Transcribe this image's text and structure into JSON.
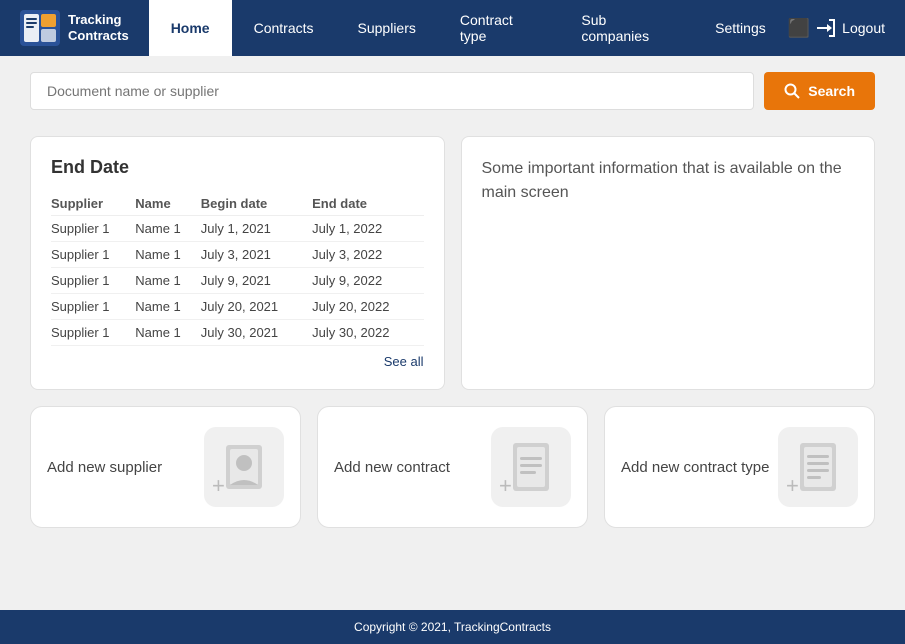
{
  "brand": {
    "name_line1": "Tracking",
    "name_line2": "Contracts"
  },
  "nav": {
    "tabs": [
      {
        "id": "home",
        "label": "Home",
        "active": true
      },
      {
        "id": "contracts",
        "label": "Contracts",
        "active": false
      },
      {
        "id": "suppliers",
        "label": "Suppliers",
        "active": false
      },
      {
        "id": "contract_type",
        "label": "Contract type",
        "active": false
      },
      {
        "id": "sub_companies",
        "label": "Sub companies",
        "active": false
      },
      {
        "id": "settings",
        "label": "Settings",
        "active": false
      }
    ],
    "logout_label": "Logout"
  },
  "search": {
    "placeholder": "Document name or supplier",
    "button_label": "Search"
  },
  "end_date_panel": {
    "title": "End Date",
    "columns": [
      "Supplier",
      "Name",
      "Begin date",
      "End date"
    ],
    "rows": [
      {
        "supplier": "Supplier 1",
        "name": "Name 1",
        "begin": "July 1, 2021",
        "end": "July 1, 2022"
      },
      {
        "supplier": "Supplier 1",
        "name": "Name 1",
        "begin": "July 3, 2021",
        "end": "July 3, 2022"
      },
      {
        "supplier": "Supplier 1",
        "name": "Name 1",
        "begin": "July 9, 2021",
        "end": "July 9, 2022"
      },
      {
        "supplier": "Supplier 1",
        "name": "Name 1",
        "begin": "July 20, 2021",
        "end": "July 20, 2022"
      },
      {
        "supplier": "Supplier 1",
        "name": "Name 1",
        "begin": "July 30, 2021",
        "end": "July 30, 2022"
      }
    ],
    "see_all_label": "See all"
  },
  "info_panel": {
    "text": "Some important information that is available on the main screen"
  },
  "action_cards": [
    {
      "id": "add-supplier",
      "label": "Add  new supplier",
      "icon_type": "person"
    },
    {
      "id": "add-contract",
      "label": "Add  new contract",
      "icon_type": "document"
    },
    {
      "id": "add-contract-type",
      "label": "Add  new contract type",
      "icon_type": "document-lines"
    }
  ],
  "footer": {
    "text": "Copyright © 2021, TrackingContracts"
  },
  "colors": {
    "brand_blue": "#1a3a6b",
    "orange": "#e8750a"
  }
}
